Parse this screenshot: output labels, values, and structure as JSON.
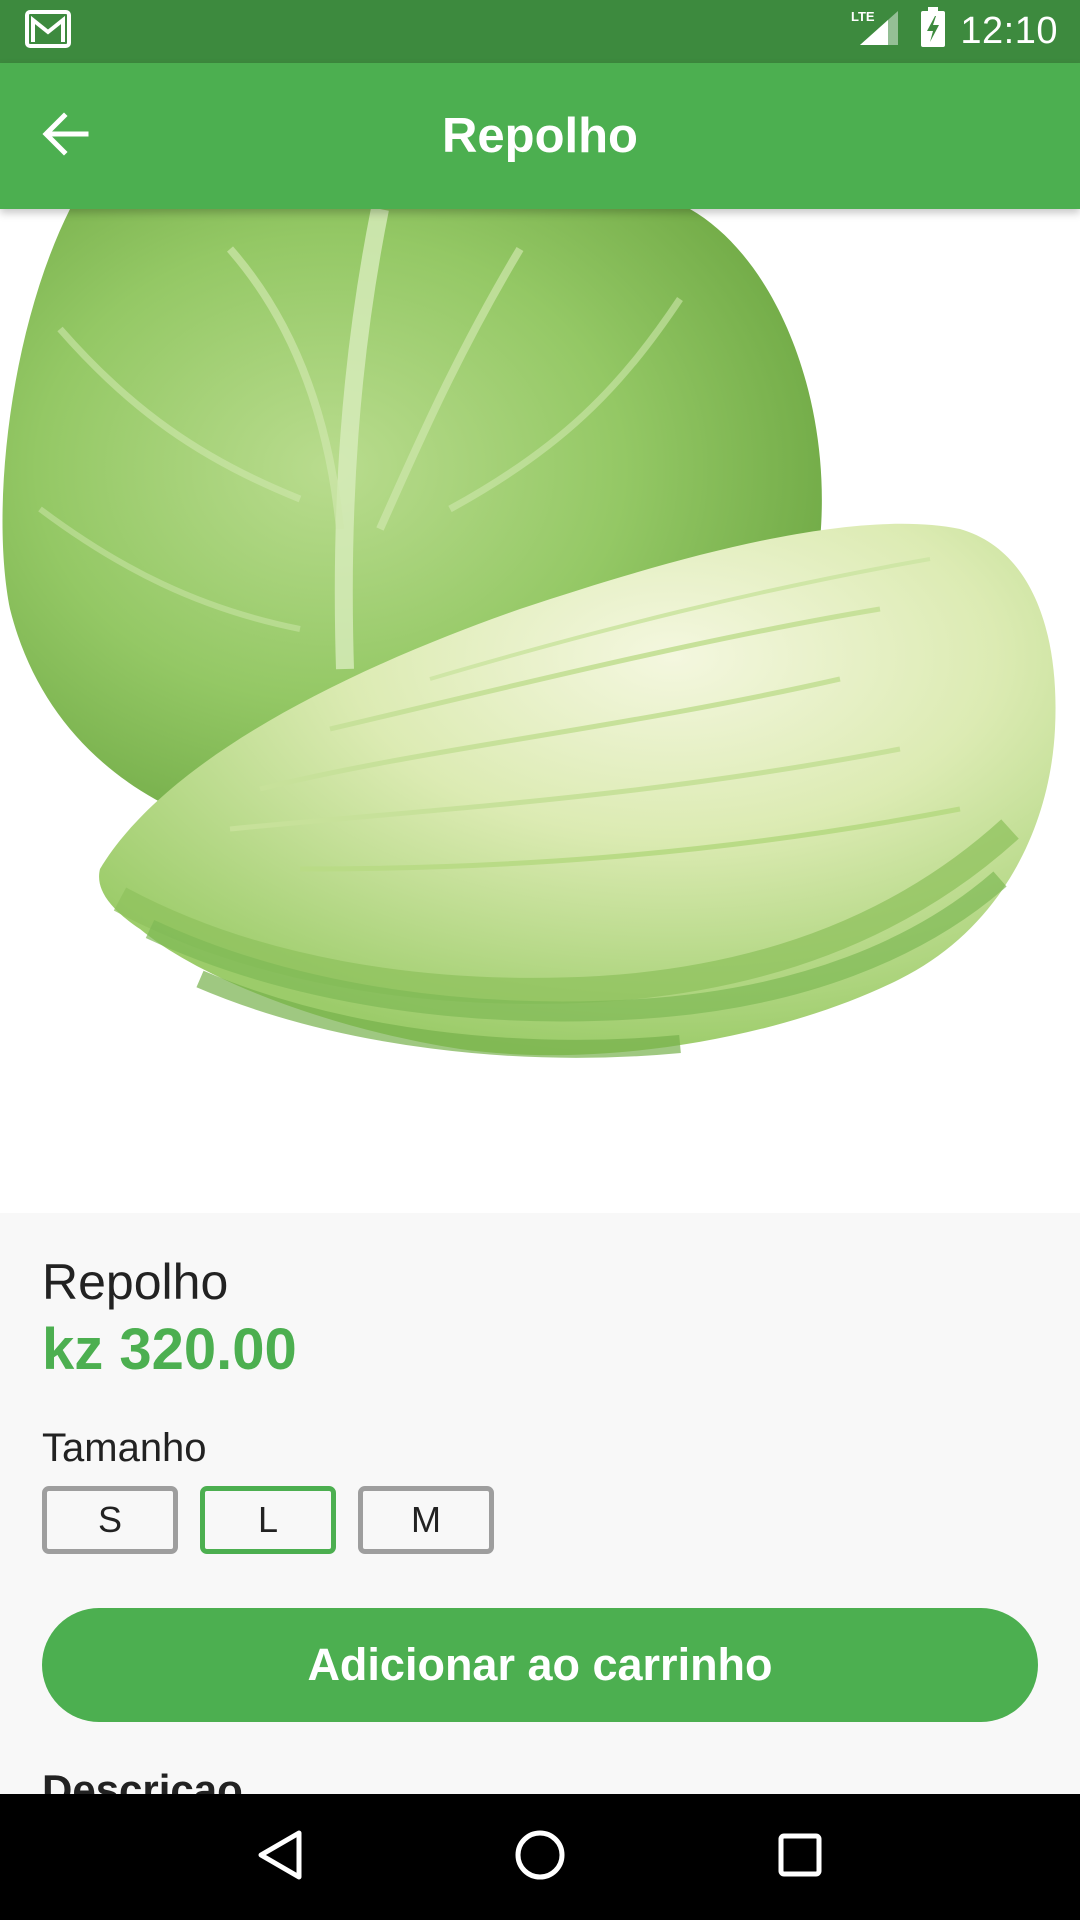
{
  "status_bar": {
    "time": "12:10",
    "network_label": "LTE",
    "icons": [
      "gmail-icon",
      "lte-signal-icon",
      "battery-charging-icon"
    ]
  },
  "app_bar": {
    "title": "Repolho",
    "back_icon": "arrow-back-icon"
  },
  "product": {
    "image_subject": "cabbage",
    "name": "Repolho",
    "price": "kz 320.00",
    "size_label": "Tamanho",
    "sizes": [
      {
        "label": "S",
        "selected": false
      },
      {
        "label": "L",
        "selected": true
      },
      {
        "label": "M",
        "selected": false
      }
    ],
    "add_to_cart_label": "Adicionar ao carrinho",
    "description_heading": "Descricao"
  },
  "nav_bar": {
    "icons": [
      "nav-back-icon",
      "nav-home-icon",
      "nav-recents-icon"
    ]
  },
  "colors": {
    "primary": "#4caf50",
    "status_bar": "#3d8a3e",
    "size_border": "#9e9e9e",
    "background": "#f8f8f8"
  }
}
